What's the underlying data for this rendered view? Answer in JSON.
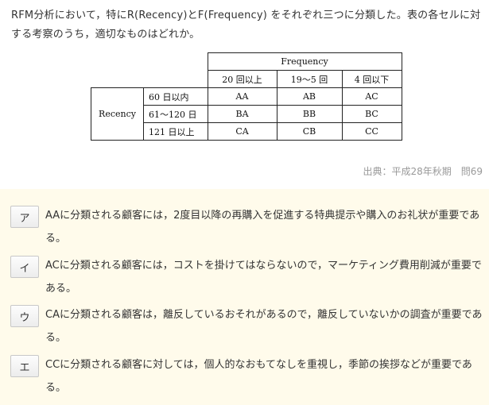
{
  "question": {
    "text": "RFM分析において，特にR(Recency)とF(Frequency) をそれぞれ三つに分類した。表の各セルに対する考察のうち，適切なものはどれか。"
  },
  "table": {
    "frequency_header": "Frequency",
    "col_headers": [
      "20 回以上",
      "19〜5 回",
      "4 回以下"
    ],
    "recency_label": "Recency",
    "rows": [
      {
        "label": "60 日以内",
        "cells": [
          "AA",
          "AB",
          "AC"
        ]
      },
      {
        "label": "61〜120 日",
        "cells": [
          "BA",
          "BB",
          "BC"
        ]
      },
      {
        "label": "121 日以上",
        "cells": [
          "CA",
          "CB",
          "CC"
        ]
      }
    ]
  },
  "source": "出典：平成28年秋期　問69",
  "choices": [
    {
      "label": "ア",
      "text": "AAに分類される顧客には，2度目以降の再購入を促進する特典提示や購入のお礼状が重要である。"
    },
    {
      "label": "イ",
      "text": "ACに分類される顧客には，コストを掛けてはならないので，マーケティング費用削減が重要である。"
    },
    {
      "label": "ウ",
      "text": "CAに分類される顧客は，離反しているおそれがあるので，離反していないかの調査が重要である。"
    },
    {
      "label": "エ",
      "text": "CCに分類される顧客に対しては，個人的なおもてなしを重視し，季節の挨拶などが重要である。"
    }
  ]
}
